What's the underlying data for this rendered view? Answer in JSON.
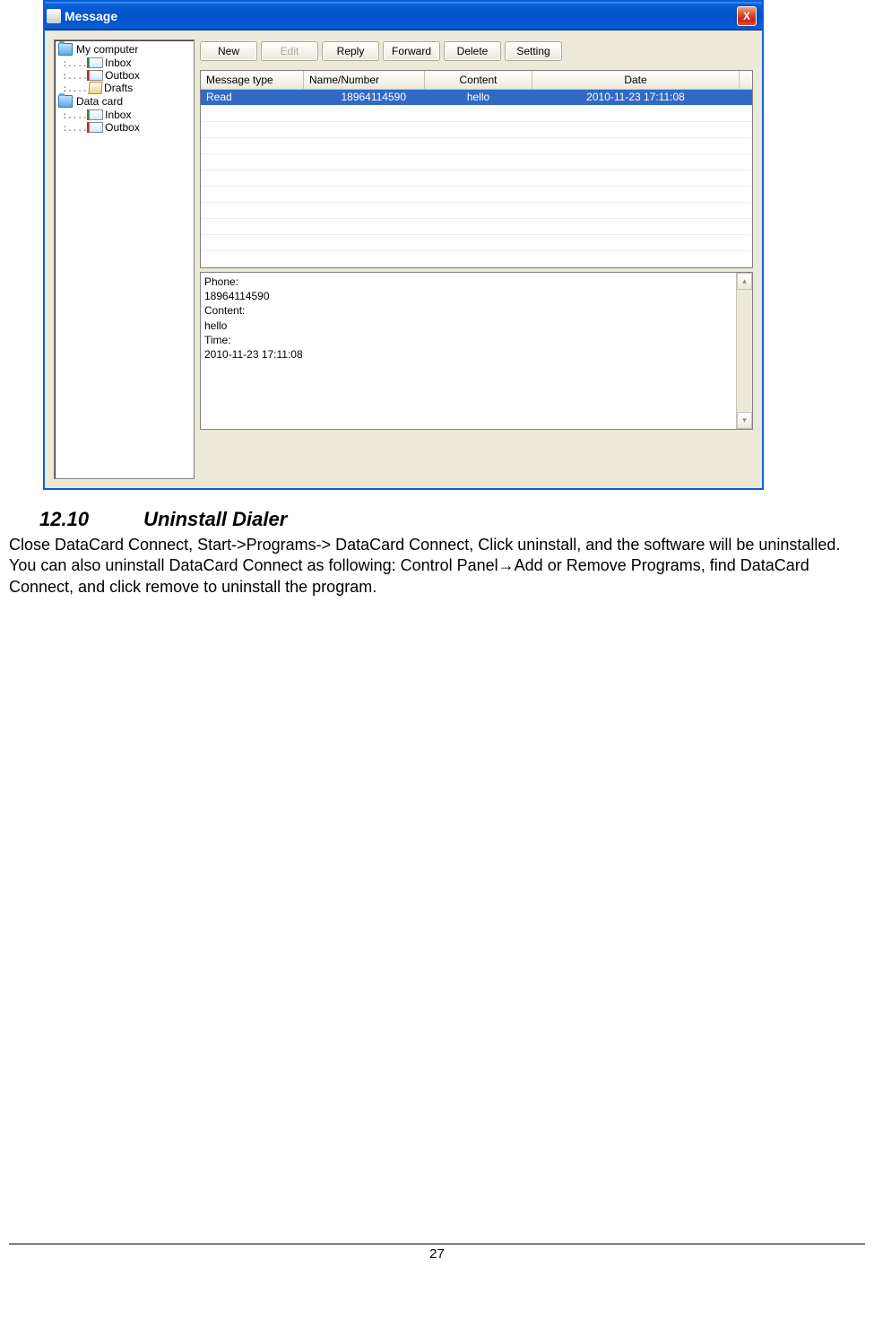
{
  "window": {
    "title": "Message",
    "close": "X"
  },
  "tree": {
    "node1": "My computer",
    "node1_children": {
      "c1": "Inbox",
      "c2": "Outbox",
      "c3": "Drafts"
    },
    "node2": "Data card",
    "node2_children": {
      "c1": "Inbox",
      "c2": "Outbox"
    }
  },
  "toolbar": {
    "new": "New",
    "edit": "Edit",
    "reply": "Reply",
    "forward": "Forward",
    "delete": "Delete",
    "setting": "Setting"
  },
  "grid": {
    "headers": {
      "h1": "Message type",
      "h2": "Name/Number",
      "h3": "Content",
      "h4": "Date"
    },
    "row": {
      "type": "Read",
      "number": "18964114590",
      "content": "hello",
      "date": "2010-11-23 17:11:08"
    }
  },
  "preview": {
    "l1": "Phone:",
    "l2": "18964114590",
    "l3": "Content:",
    "l4": "hello",
    "l5": "Time:",
    "l6": "2010-11-23 17:11:08"
  },
  "section": {
    "number": "12.10",
    "title": "Uninstall Dialer",
    "body": "Close DataCard Connect, Start->Programs-> DataCard Connect, Click uninstall, and the software will be uninstalled. You can also uninstall DataCard Connect as following: Control Panel→Add or Remove Programs, find DataCard Connect, and click remove to uninstall the program."
  },
  "page_number": "27"
}
